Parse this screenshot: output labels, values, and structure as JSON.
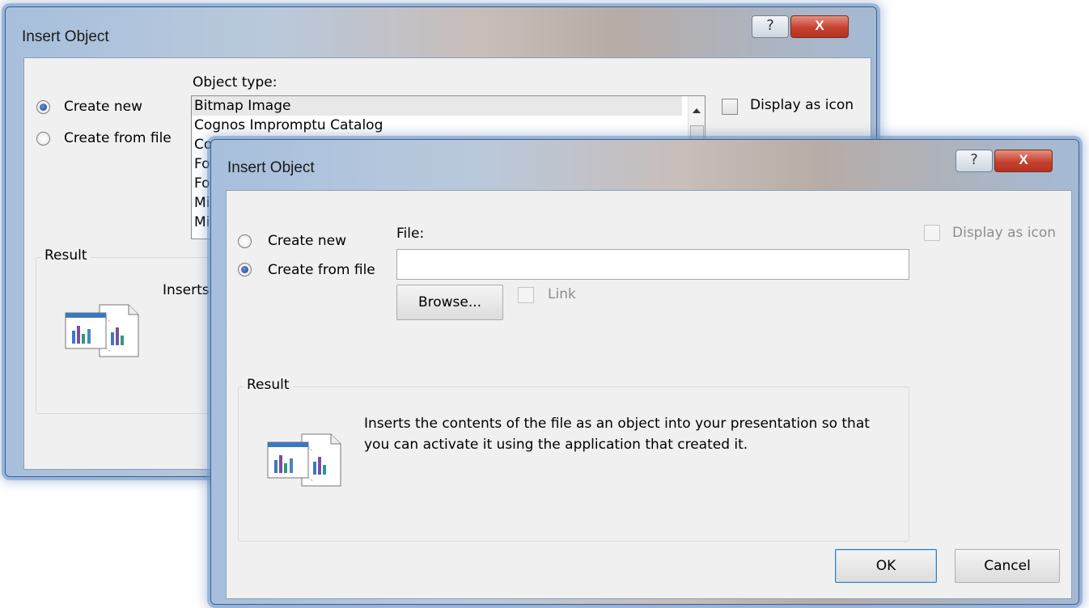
{
  "back_dialog": {
    "title": "Insert Object",
    "help_label": "?",
    "close_label": "X",
    "radio_create_new": "Create new",
    "radio_create_from_file": "Create from file",
    "object_type_label": "Object type:",
    "object_types": [
      "Bitmap Image",
      "Cognos Impromptu Catalog",
      "Co",
      "Fo",
      "Fo",
      "Mi",
      "Mi"
    ],
    "display_as_icon_label": "Display as icon",
    "result_title": "Result",
    "result_text": "Inserts"
  },
  "front_dialog": {
    "title": "Insert Object",
    "help_label": "?",
    "close_label": "X",
    "radio_create_new": "Create new",
    "radio_create_from_file": "Create from file",
    "file_label": "File:",
    "file_value": "",
    "browse_label": "Browse...",
    "link_label": "Link",
    "display_as_icon_label": "Display as icon",
    "result_title": "Result",
    "result_text": "Inserts the contents of the file as an object into your presentation so that you can activate it using the application that created it.",
    "ok_label": "OK",
    "cancel_label": "Cancel"
  },
  "colors": {
    "close_button": "#c6422f",
    "window_frame": "#a7bfdc",
    "selected_radio": "#1b3c8e"
  }
}
